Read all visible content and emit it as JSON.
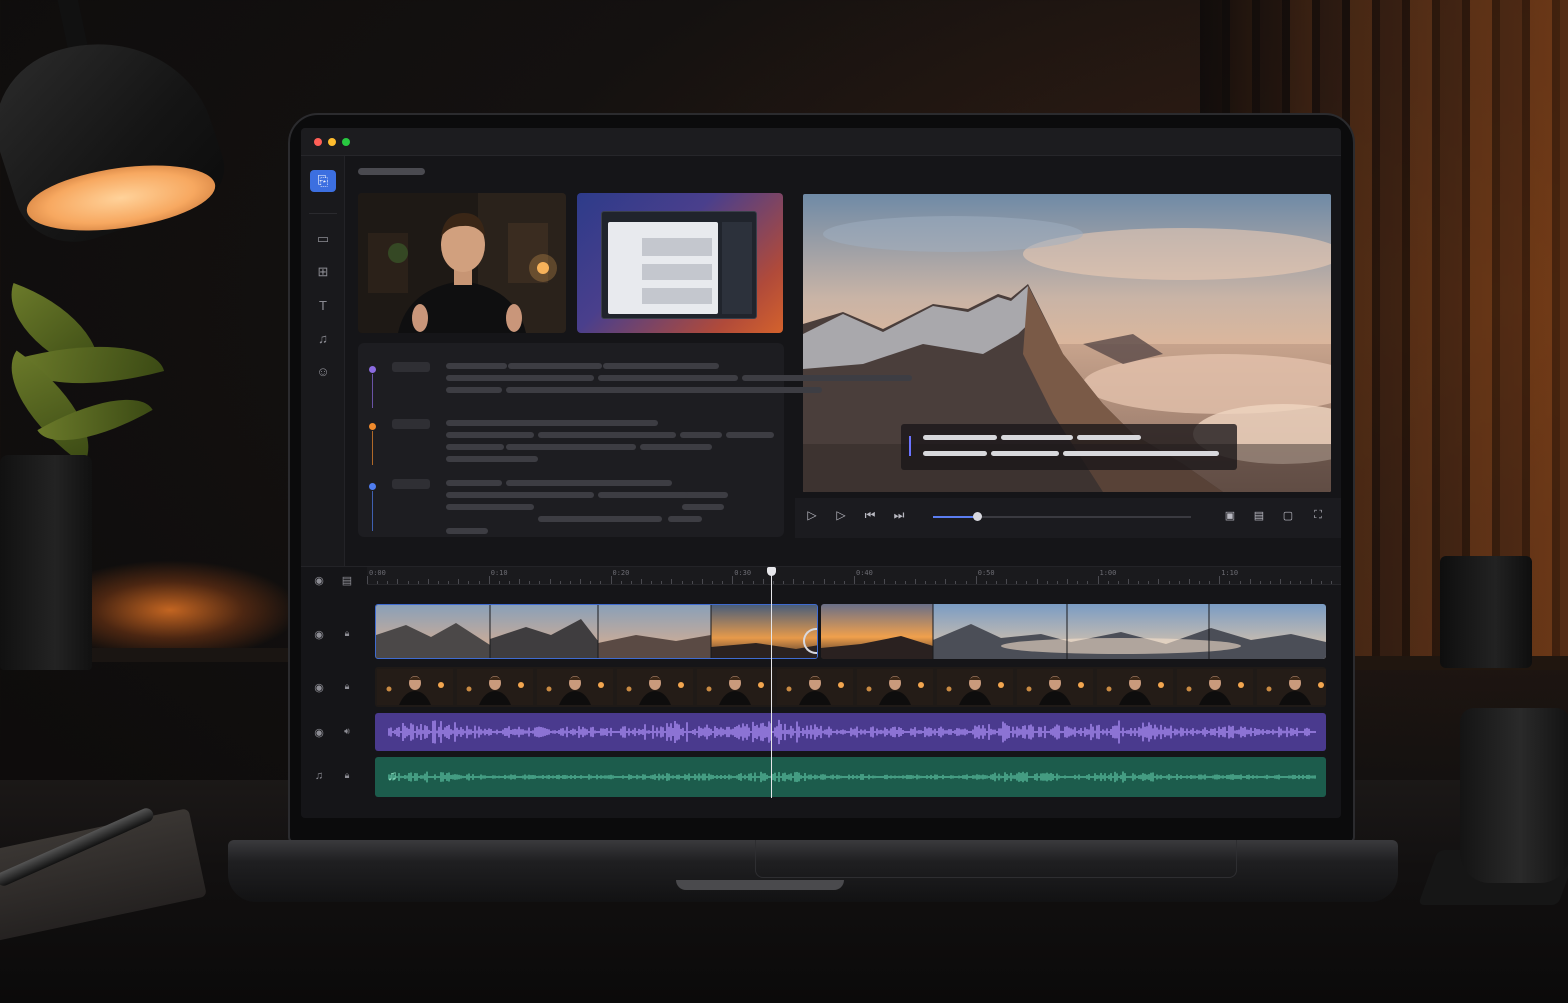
{
  "app": {
    "window_buttons": [
      "close",
      "minimize",
      "maximize"
    ],
    "accent_color": "#3c6fe0"
  },
  "sidebar": {
    "items": [
      {
        "name": "import-media",
        "icon": "import-icon",
        "glyph": "⎘",
        "active": true
      },
      {
        "name": "media-library",
        "icon": "folder-icon",
        "glyph": "▭",
        "active": false
      },
      {
        "name": "effects",
        "icon": "effects-icon",
        "glyph": "⊞",
        "active": false
      },
      {
        "name": "text",
        "icon": "text-icon",
        "glyph": "T",
        "active": false
      },
      {
        "name": "audio",
        "icon": "music-note-icon",
        "glyph": "♫",
        "active": false
      },
      {
        "name": "stickers",
        "icon": "smiley-icon",
        "glyph": "☺",
        "active": false
      }
    ]
  },
  "media": {
    "thumbnails": [
      {
        "name": "presenter-clip",
        "kind": "webcam"
      },
      {
        "name": "screen-recording-clip",
        "kind": "screen"
      }
    ]
  },
  "transcript": {
    "segments": [
      {
        "color": "#8b6be0"
      },
      {
        "color": "#f08a2c"
      },
      {
        "color": "#4f7df0"
      }
    ]
  },
  "player": {
    "progress": 0.17,
    "controls": [
      {
        "name": "play-button",
        "icon": "play-icon",
        "glyph": "▷"
      },
      {
        "name": "step-play-button",
        "icon": "play-outline-icon",
        "glyph": "▷"
      },
      {
        "name": "rewind-button",
        "icon": "skip-back-icon",
        "glyph": "⏮"
      },
      {
        "name": "forward-button",
        "icon": "skip-forward-icon",
        "glyph": "⏭"
      }
    ],
    "right_controls": [
      {
        "name": "aspect-ratio-button",
        "icon": "aspect-icon",
        "glyph": "▣"
      },
      {
        "name": "safe-area-button",
        "icon": "frame-icon",
        "glyph": "▤"
      },
      {
        "name": "quality-button",
        "icon": "hd-icon",
        "glyph": "▢"
      },
      {
        "name": "fullscreen-button",
        "icon": "fullscreen-icon",
        "glyph": "⛶"
      }
    ]
  },
  "timeline": {
    "ruler_labels": [
      "0:00",
      "0:10",
      "0:20",
      "0:30",
      "0:40",
      "0:50",
      "1:00",
      "1:10",
      "1:20"
    ],
    "playhead_fraction": 0.42,
    "header_controls": [
      {
        "name": "eye-icon",
        "glyph": "◉"
      },
      {
        "name": "list-icon",
        "glyph": "▤"
      }
    ],
    "tracks": [
      {
        "name": "video-track-landscape",
        "left_icon": "eye-icon",
        "left_glyph": "◉",
        "right_icon": "lock-icon",
        "right_glyph": "🔒︎",
        "clip_color": "#1f3a66"
      },
      {
        "name": "video-track-presenter",
        "left_icon": "eye-icon",
        "left_glyph": "◉",
        "right_icon": "lock-icon",
        "right_glyph": "🔒︎",
        "clip_color": "#1f1a17"
      },
      {
        "name": "audio-track-voice",
        "left_icon": "eye-icon",
        "left_glyph": "◉",
        "right_icon": "speaker-icon",
        "right_glyph": "🔊︎",
        "clip_color": "#4a3a8e"
      },
      {
        "name": "audio-track-music",
        "left_icon": "music-note-icon",
        "left_glyph": "♫",
        "right_icon": "lock-icon",
        "right_glyph": "🔒︎",
        "clip_color": "#1c5c4c"
      }
    ]
  }
}
